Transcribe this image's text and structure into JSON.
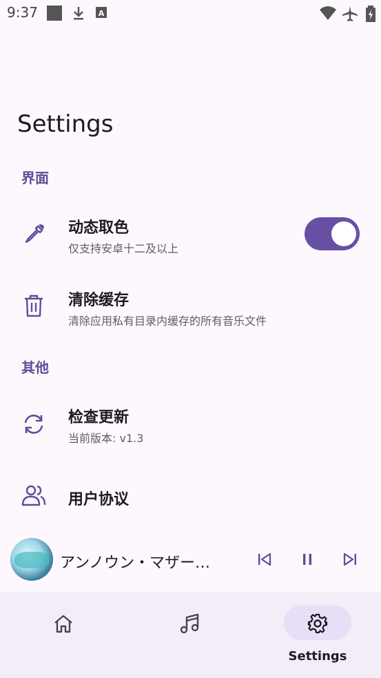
{
  "status_bar": {
    "time": "9:37",
    "icons": [
      "square-notification-icon",
      "download-icon",
      "font-icon",
      "wifi-icon",
      "airplane-icon",
      "battery-charging-icon"
    ]
  },
  "page": {
    "title": "Settings"
  },
  "sections": [
    {
      "header": "界面",
      "items": [
        {
          "icon": "eyedropper-icon",
          "title": "动态取色",
          "subtitle": "仅支持安卓十二及以上",
          "toggle_on": true
        },
        {
          "icon": "trash-icon",
          "title": "清除缓存",
          "subtitle": "清除应用私有目录内缓存的所有音乐文件"
        }
      ]
    },
    {
      "header": "其他",
      "items": [
        {
          "icon": "sync-icon",
          "title": "检查更新",
          "subtitle": "当前版本: v1.3"
        },
        {
          "icon": "users-icon",
          "title": "用户协议"
        }
      ]
    }
  ],
  "now_playing": {
    "title": "アンノウン・マザー…",
    "controls": [
      "previous-icon",
      "pause-icon",
      "next-icon"
    ]
  },
  "bottom_nav": {
    "items": [
      {
        "icon": "home-icon",
        "label": ""
      },
      {
        "icon": "music-note-icon",
        "label": ""
      },
      {
        "icon": "gear-icon",
        "label": "Settings",
        "active": true
      }
    ]
  },
  "colors": {
    "accent": "#6750a4",
    "section_header": "#5c4d9a",
    "background": "#fdf8fd",
    "nav_background": "#f2edf7",
    "nav_pill": "#e8def8"
  }
}
